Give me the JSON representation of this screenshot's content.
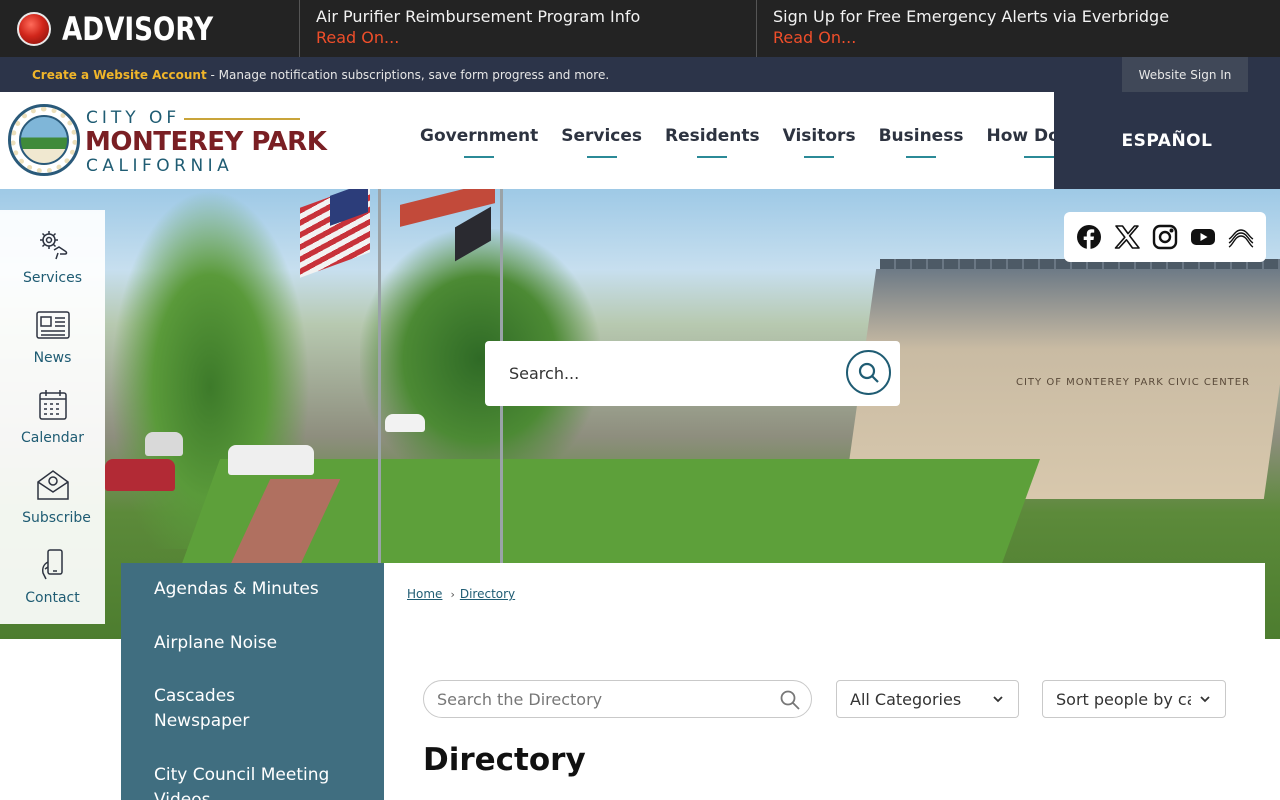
{
  "advisory": {
    "label": "ADVISORY",
    "items": [
      {
        "title": "Air Purifier Reimbursement Program Info",
        "link": "Read On..."
      },
      {
        "title": "Sign Up for Free Emergency Alerts via Everbridge",
        "link": "Read On..."
      }
    ]
  },
  "account_bar": {
    "link": "Create a Website Account",
    "text": " - Manage notification subscriptions, save form progress and more.",
    "signin": "Website Sign In"
  },
  "logo": {
    "city_of": "CITY OF",
    "name": "MONTEREY PARK",
    "state": "CALIFORNIA"
  },
  "nav": [
    "Government",
    "Services",
    "Residents",
    "Visitors",
    "Business",
    "How Do I..."
  ],
  "language": "ESPAÑOL",
  "hero": {
    "search_placeholder": "Search...",
    "building_sign": "CITY OF MONTEREY PARK CIVIC CENTER"
  },
  "quick_links": [
    {
      "label": "Services",
      "icon": "gear-hand-icon"
    },
    {
      "label": "News",
      "icon": "newspaper-icon"
    },
    {
      "label": "Calendar",
      "icon": "calendar-icon"
    },
    {
      "label": "Subscribe",
      "icon": "mail-icon"
    },
    {
      "label": "Contact",
      "icon": "phone-icon"
    }
  ],
  "social": [
    "facebook-icon",
    "x-icon",
    "instagram-icon",
    "youtube-icon",
    "waves-icon"
  ],
  "left_menu": [
    "Agendas & Minutes",
    "Airplane Noise",
    "Cascades Newspaper",
    "City Council Meeting Videos"
  ],
  "breadcrumb": [
    "Home",
    "Directory"
  ],
  "directory": {
    "search_placeholder": "Search the Directory",
    "category_select": "All Categories",
    "sort_select": "Sort people by category",
    "title": "Directory"
  },
  "colors": {
    "advisory_bg": "#232323",
    "advisory_link": "#ef4e2a",
    "navy": "#2c3449",
    "gold": "#f0b52a",
    "teal": "#1f5c73",
    "menu_bg": "#406e80",
    "maroon": "#7a1f24"
  }
}
